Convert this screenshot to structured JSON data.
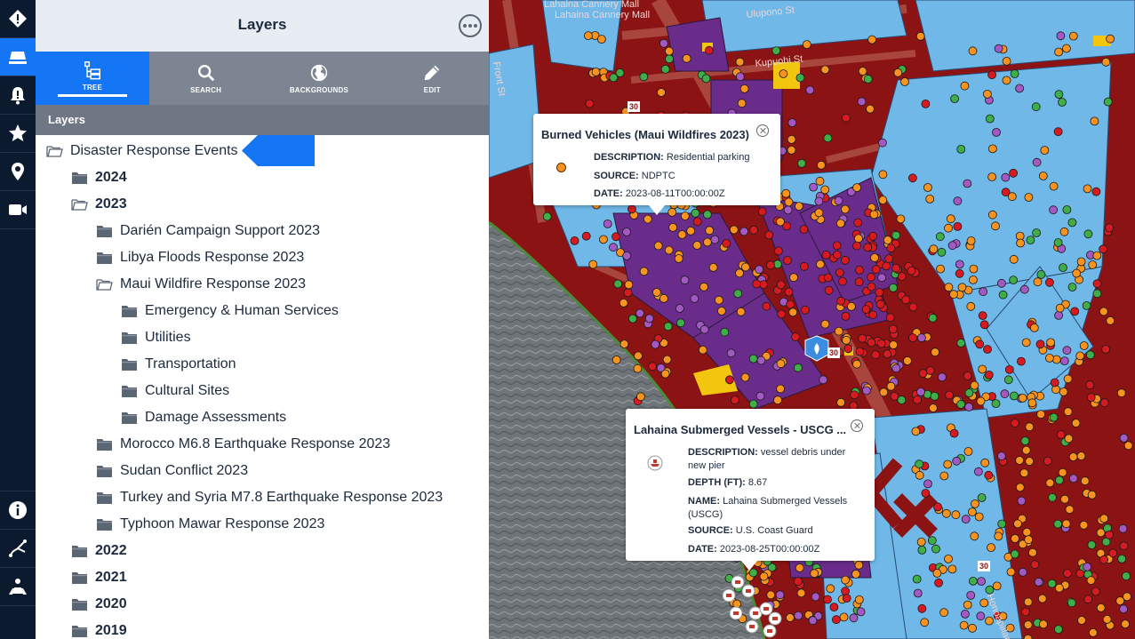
{
  "panel": {
    "title": "Layers",
    "tabs": [
      {
        "label": "TREE",
        "icon": "tree-icon"
      },
      {
        "label": "SEARCH",
        "icon": "search-icon"
      },
      {
        "label": "BACKGROUNDS",
        "icon": "globe-icon"
      },
      {
        "label": "EDIT",
        "icon": "pencil-icon"
      }
    ],
    "section_label": "Layers"
  },
  "tree": {
    "root": "Disaster Response Events",
    "y2024": "2024",
    "y2023": "2023",
    "darien": "Darién Campaign Support 2023",
    "libya": "Libya Floods Response 2023",
    "maui": "Maui Wildfire Response 2023",
    "emergency": "Emergency & Human Services",
    "utilities": "Utilities",
    "transportation": "Transportation",
    "cultural": "Cultural Sites",
    "damage": "Damage Assessments",
    "morocco": "Morocco M6.8 Earthquake Response 2023",
    "sudan": "Sudan Conflict 2023",
    "turkey": "Turkey and Syria M7.8 Earthquake Response 2023",
    "mawar": "Typhoon Mawar Response 2023",
    "y2022": "2022",
    "y2021": "2021",
    "y2020": "2020",
    "y2019": "2019"
  },
  "rail": {
    "items": [
      "alert-icon",
      "layers-icon",
      "notification-icon",
      "star-icon",
      "location-pin-icon",
      "video-icon",
      "info-icon",
      "route-icon",
      "map-person-icon"
    ]
  },
  "map": {
    "streets": [
      "Lahaina Cannery Mall",
      "Front St",
      "Ulupono St",
      "Kupuohi St",
      "Honoapiilani Hwy",
      "30"
    ],
    "popup1": {
      "title": "Burned Vehicles (Maui Wildfires 2023)",
      "desc_label": "DESCRIPTION:",
      "desc": "Residential parking",
      "source_label": "SOURCE:",
      "source": "NDPTC",
      "date_label": "DATE:",
      "date": "2023-08-11T00:00:00Z",
      "marker_color": "#f7931e"
    },
    "popup2": {
      "title": "Lahaina Submerged Vessels - USCG ...",
      "desc_label": "DESCRIPTION:",
      "desc": "vessel debris under new pier",
      "depth_label": "DEPTH (FT):",
      "depth": "8.67",
      "name_label": "NAME:",
      "name": "Lahaina Submerged Vessels (USCG)",
      "source_label": "SOURCE:",
      "source": "U.S. Coast Guard",
      "date_label": "DATE:",
      "date": "2023-08-25T00:00:00Z"
    }
  },
  "colors": {
    "accent": "#1576f5",
    "rail": "#0c1a30",
    "burn_area": "#8b1313",
    "parcel_blue": "#6fb8e8",
    "parcel_purple": "#6a2c8a",
    "marker_orange": "#f7931e",
    "marker_red": "#d71920",
    "marker_purple": "#a259c4"
  }
}
